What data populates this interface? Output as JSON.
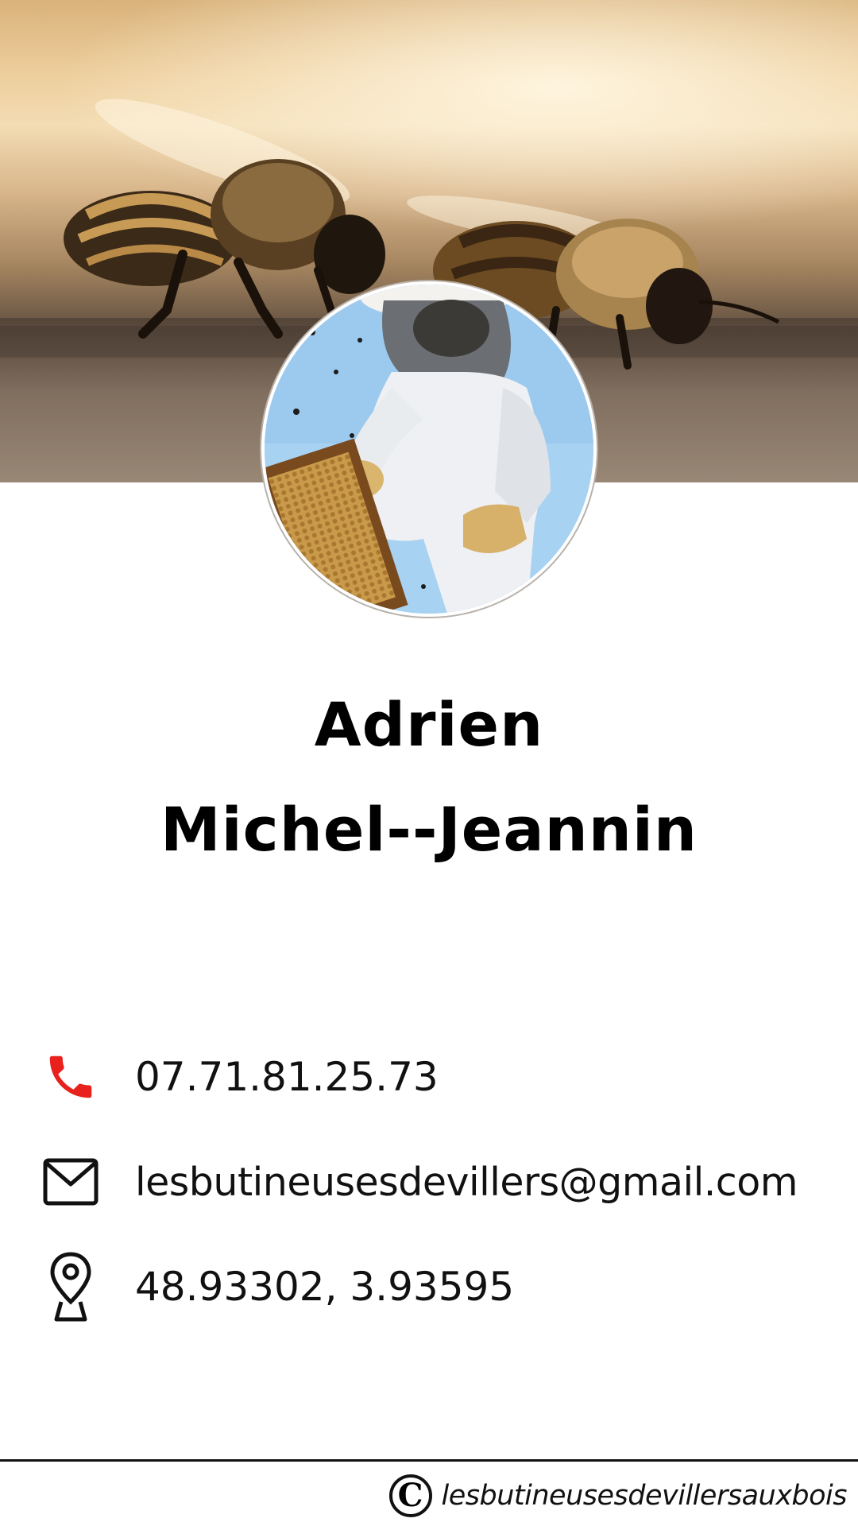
{
  "profile": {
    "first_name": "Adrien",
    "last_name": "Michel--Jeannin"
  },
  "contacts": {
    "phone": {
      "icon": "phone-icon",
      "value": "07.71.81.25.73",
      "color": "#e8211c"
    },
    "email": {
      "icon": "mail-icon",
      "value": "lesbutineusesdevillers@gmail.com"
    },
    "location": {
      "icon": "map-pin-icon",
      "value": "48.93302, 3.93595"
    }
  },
  "footer": {
    "copyright_symbol": "C",
    "site": "lesbutineusesdevillersauxbois"
  },
  "colors": {
    "accent_phone": "#e8211c",
    "text": "#111111",
    "background": "#ffffff"
  }
}
